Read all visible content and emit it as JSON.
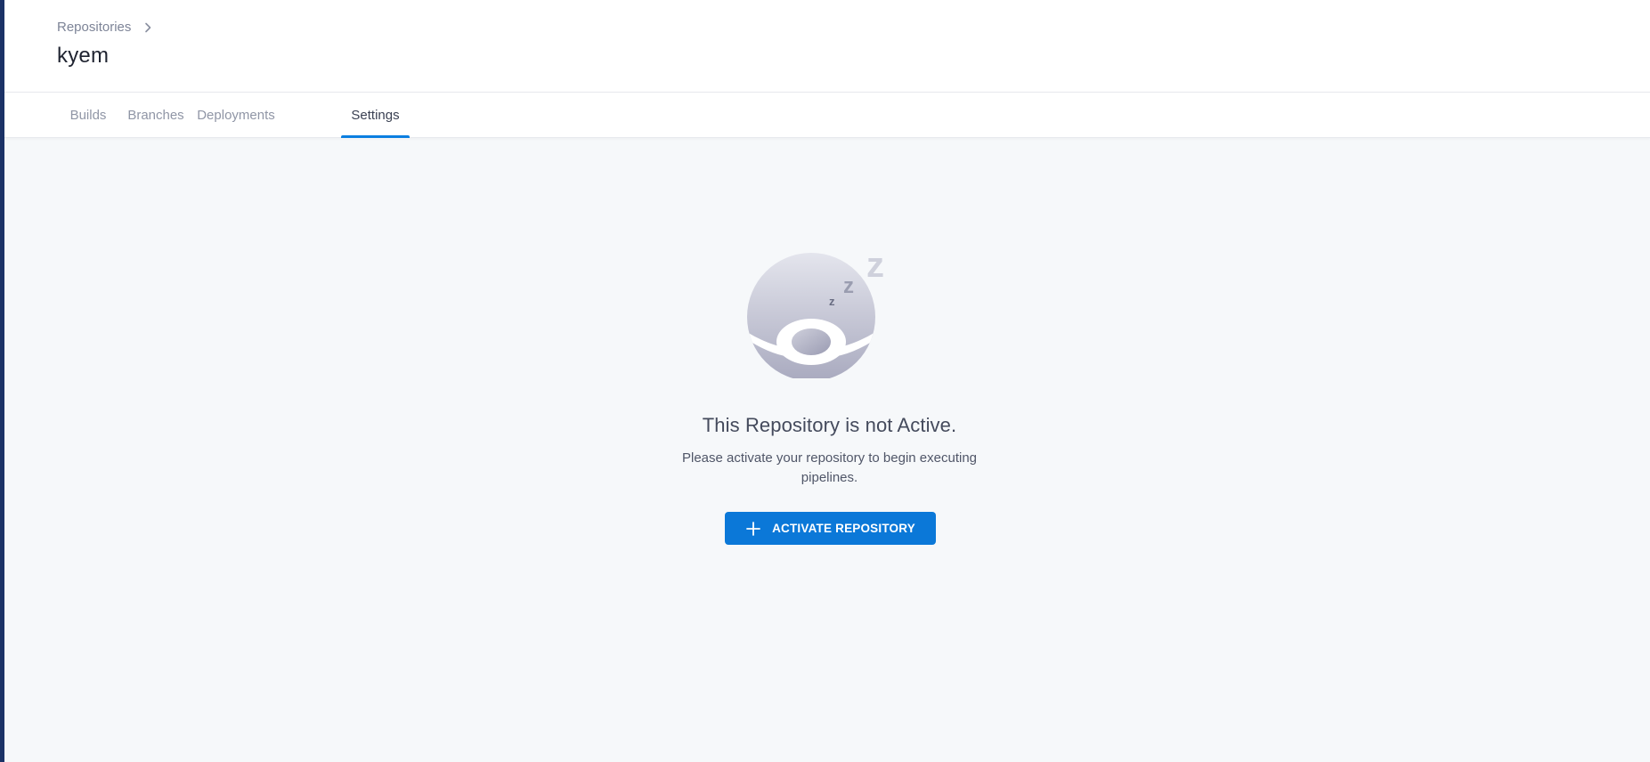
{
  "header": {
    "breadcrumb": {
      "parent_label": "Repositories"
    },
    "title": "kyem"
  },
  "tabs": [
    {
      "label": "Builds",
      "active": false
    },
    {
      "label": "Branches",
      "active": false
    },
    {
      "label": "Deployments",
      "active": false
    },
    {
      "label": "Settings",
      "active": true
    }
  ],
  "empty_state": {
    "illustration": "sleeping-ball-icon",
    "title": "This Repository is not Active.",
    "description": "Please activate your repository to begin executing pipelines.",
    "button": {
      "icon": "plus-icon",
      "label": "ACTIVATE REPOSITORY"
    }
  },
  "colors": {
    "accent": "#0b78d8",
    "sidebar_rail": "#1b3266",
    "background": "#f6f8fa"
  }
}
